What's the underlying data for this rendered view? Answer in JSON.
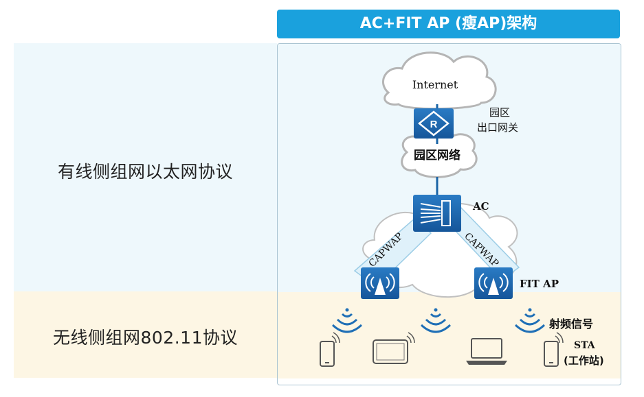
{
  "header": {
    "title": "AC+FIT AP (瘦AP)架构"
  },
  "sections": {
    "wired": "有线侧组网以太网协议",
    "wireless": "无线侧组网802.11协议"
  },
  "nodes": {
    "internet": "Internet",
    "gateway_line1": "园区",
    "gateway_line2": "出口网关",
    "campus_network": "园区网络",
    "ac": "AC",
    "fit_ap": "FIT AP",
    "capwap_left": "CAPWAP",
    "capwap_right": "CAPWAP",
    "radio_signal": "射频信号",
    "sta_line1": "STA",
    "sta_line2": "(工作站)"
  },
  "colors": {
    "header_bg": "#1aa1dd",
    "device_blue": "#1a64a6",
    "wired_bg": "#eef8fc",
    "wireless_bg": "#fdf6e4",
    "signal_blue": "#1f6fb6",
    "cloud_stroke": "#b5b5b5"
  }
}
